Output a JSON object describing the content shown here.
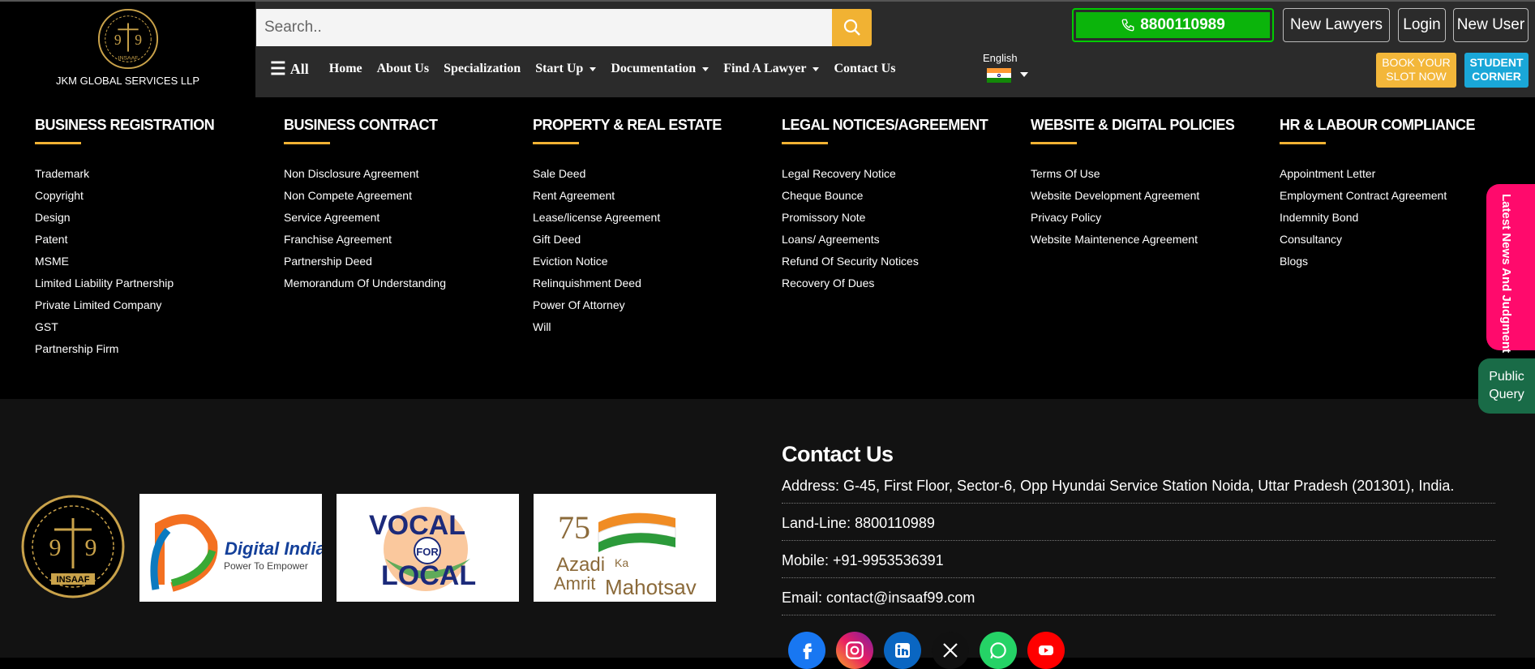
{
  "header": {
    "brand_name": "JKM GLOBAL SERVICES LLP",
    "logo_text_top": "9",
    "logo_text_bottom": "9",
    "logo_word": "INSAAF",
    "search_placeholder": "Search..",
    "nav": {
      "all": "All",
      "items": [
        "Home",
        "About Us",
        "Specialization",
        "Start Up",
        "Documentation",
        "Find A Lawyer",
        "Contact Us"
      ]
    },
    "language": "English",
    "phone": "8800110989",
    "new_lawyers": "New Lawyers",
    "login": "Login",
    "new_user": "New User",
    "book_line1": "BOOK YOUR",
    "book_line2": "SLOT NOW",
    "student_line1": "STUDENT",
    "student_line2": "CORNER"
  },
  "menu": {
    "columns": [
      {
        "title": "BUSINESS REGISTRATION",
        "items": [
          "Trademark",
          "Copyright",
          "Design",
          "Patent",
          "MSME",
          "Limited Liability Partnership",
          "Private Limited Company",
          "GST",
          "Partnership Firm"
        ]
      },
      {
        "title": "BUSINESS CONTRACT",
        "items": [
          "Non Disclosure Agreement",
          "Non Compete Agreement",
          "Service Agreement",
          "Franchise Agreement",
          "Partnership Deed",
          "Memorandum Of Understanding"
        ]
      },
      {
        "title": "PROPERTY & REAL ESTATE",
        "items": [
          "Sale Deed",
          "Rent Agreement",
          "Lease/license Agreement",
          "Gift Deed",
          "Eviction Notice",
          "Relinquishment Deed",
          "Power Of Attorney",
          "Will"
        ]
      },
      {
        "title": "LEGAL NOTICES/AGREEMENT",
        "items": [
          "Legal Recovery Notice",
          "Cheque Bounce",
          "Promissory Note",
          "Loans/ Agreements",
          "Refund Of Security Notices",
          "Recovery Of Dues"
        ]
      },
      {
        "title": "WEBSITE & DIGITAL POLICIES",
        "items": [
          "Terms Of Use",
          "Website Development Agreement",
          "Privacy Policy",
          "Website Maintenence Agreement"
        ]
      },
      {
        "title": "HR & LABOUR COMPLIANCE",
        "items": [
          "Appointment Letter",
          "Employment Contract Agreement",
          "Indemnity Bond",
          "Consultancy",
          "Blogs"
        ]
      }
    ]
  },
  "side": {
    "news": "Latest News And Judgment",
    "query_line1": "Public",
    "query_line2": "Query"
  },
  "footer": {
    "badges": {
      "digital_title": "Digital India",
      "digital_sub": "Power To Empower",
      "vocal": "VOCAL",
      "for": "FOR",
      "local": "LOCAL",
      "azadi_num": "75",
      "azadi_1": "Azadi",
      "azadi_ka": "Ka",
      "azadi_2": "Amrit",
      "azadi_3": "Mahotsav"
    },
    "contact": {
      "title": "Contact Us",
      "address": "Address: G-45, First Floor, Sector-6, Opp Hyundai Service Station Noida, Uttar Pradesh (201301), India.",
      "landline": "Land-Line: 8800110989",
      "mobile": "Mobile: +91-9953536391",
      "email": "Email: contact@insaaf99.com"
    },
    "social": [
      "facebook",
      "instagram",
      "linkedin",
      "x",
      "whatsapp",
      "youtube"
    ]
  },
  "colors": {
    "accent": "#f1b233",
    "phone_green": "#0bb40b",
    "news_pink": "#ff0a6c",
    "query_green": "#196b47",
    "student_blue": "#1aa7d8"
  }
}
